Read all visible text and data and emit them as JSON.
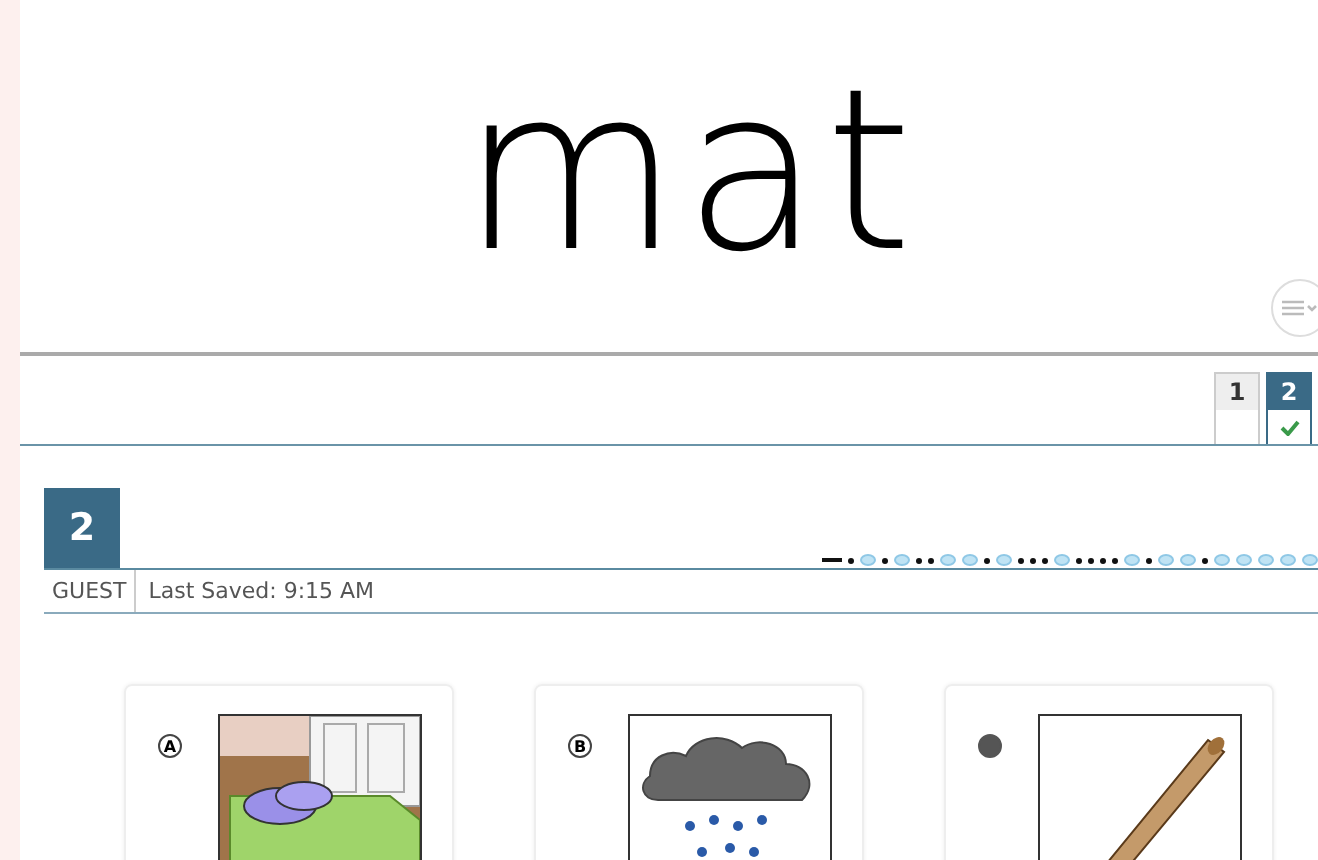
{
  "word": "mat",
  "page_tabs": [
    {
      "label": "1",
      "selected": false,
      "answered": false
    },
    {
      "label": "2",
      "selected": true,
      "answered": true
    }
  ],
  "question": {
    "number": "2",
    "user": "GUEST",
    "saved": "Last Saved: 9:15 AM"
  },
  "progress_markers": [
    {
      "current": true,
      "answered": true
    },
    {
      "current": false,
      "answered": true
    },
    {
      "current": false,
      "answered": false
    },
    {
      "current": false,
      "answered": true
    },
    {
      "current": false,
      "answered": false
    },
    {
      "current": false,
      "answered": true
    },
    {
      "current": false,
      "answered": true
    },
    {
      "current": false,
      "answered": false
    },
    {
      "current": false,
      "answered": false
    },
    {
      "current": false,
      "answered": true
    },
    {
      "current": false,
      "answered": false
    },
    {
      "current": false,
      "answered": true
    },
    {
      "current": false,
      "answered": true
    },
    {
      "current": false,
      "answered": true
    },
    {
      "current": false,
      "answered": false
    },
    {
      "current": false,
      "answered": true
    },
    {
      "current": false,
      "answered": true
    },
    {
      "current": false,
      "answered": true
    },
    {
      "current": false,
      "answered": true
    },
    {
      "current": false,
      "answered": false
    },
    {
      "current": false,
      "answered": true
    },
    {
      "current": false,
      "answered": false
    },
    {
      "current": false,
      "answered": false
    },
    {
      "current": false,
      "answered": true
    },
    {
      "current": false,
      "answered": false
    },
    {
      "current": false,
      "answered": false
    },
    {
      "current": false,
      "answered": false
    },
    {
      "current": false,
      "answered": false
    },
    {
      "current": false,
      "answered": false
    }
  ],
  "choices": [
    {
      "letter": "A",
      "selected": false,
      "kind": "doormat"
    },
    {
      "letter": "B",
      "selected": false,
      "kind": "rain"
    },
    {
      "selected": true,
      "kind": "bat"
    }
  ]
}
